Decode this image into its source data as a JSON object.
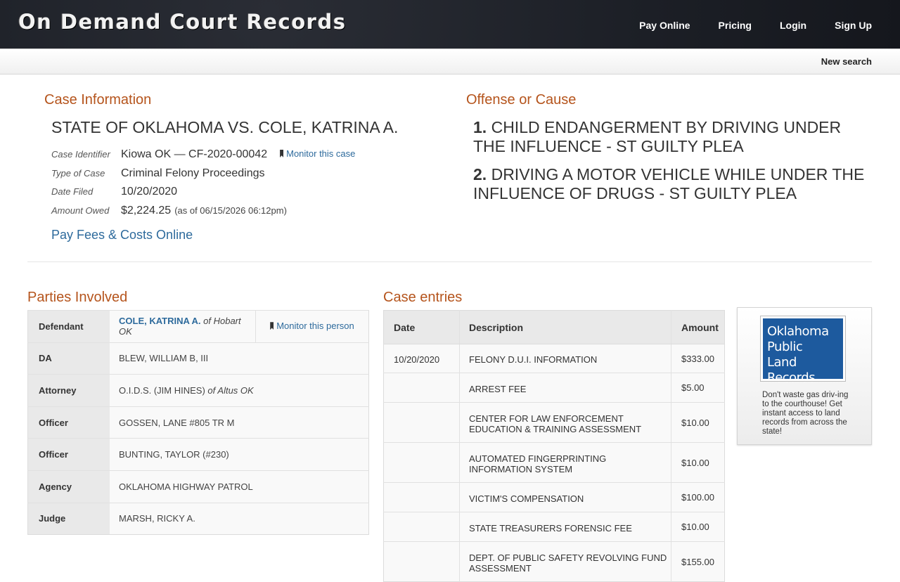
{
  "header": {
    "logo": "On Demand Court Records",
    "nav": [
      "Pay Online",
      "Pricing",
      "Login",
      "Sign Up"
    ],
    "new_search": "New search"
  },
  "case_info": {
    "heading": "Case Information",
    "title": "STATE OF OKLAHOMA VS. COLE, KATRINA A.",
    "fields": [
      {
        "label": "Case Identifier",
        "value": "Kiowa OK — CF-2020-00042"
      },
      {
        "label": "Type of Case",
        "value": "Criminal Felony Proceedings"
      },
      {
        "label": "Date Filed",
        "value": "10/20/2020"
      },
      {
        "label": "Amount Owed",
        "value": "$2,224.25",
        "note": "(as of 06/15/2026 06:12pm)"
      }
    ],
    "monitor_case": "Monitor this case",
    "pay_link": "Pay Fees & Costs Online"
  },
  "offense": {
    "heading": "Offense or Cause",
    "items": [
      {
        "num": "1.",
        "text": "CHILD ENDANGERMENT BY DRIVING UNDER THE INFLUENCE - ST GUILTY PLEA"
      },
      {
        "num": "2.",
        "text": "DRIVING A MOTOR VEHICLE WHILE UNDER THE INFLUENCE OF DRUGS - ST GUILTY PLEA"
      }
    ]
  },
  "parties": {
    "heading": "Parties Involved",
    "rows": [
      {
        "role": "Defendant",
        "name": "COLE, KATRINA A.",
        "suffix": "of Hobart OK",
        "monitor": "Monitor this person"
      },
      {
        "role": "DA",
        "name": "BLEW, WILLIAM B, III"
      },
      {
        "role": "Attorney",
        "name": "O.I.D.S. (JIM HINES)",
        "suffix": "of Altus OK"
      },
      {
        "role": "Officer",
        "name": "GOSSEN, LANE #805 TR M"
      },
      {
        "role": "Officer",
        "name": "BUNTING, TAYLOR (#230)"
      },
      {
        "role": "Agency",
        "name": "OKLAHOMA HIGHWAY PATROL"
      },
      {
        "role": "Judge",
        "name": "MARSH, RICKY A."
      }
    ]
  },
  "entries": {
    "heading": "Case entries",
    "columns": [
      "Date",
      "Description",
      "Amount"
    ],
    "rows": [
      {
        "date": "10/20/2020",
        "desc": "FELONY D.U.I. INFORMATION",
        "amount": "$333.00"
      },
      {
        "date": "",
        "desc": "ARREST FEE",
        "amount": "$5.00"
      },
      {
        "date": "",
        "desc": "CENTER FOR LAW ENFORCEMENT EDUCATION & TRAINING ASSESSMENT",
        "amount": "$10.00"
      },
      {
        "date": "",
        "desc": "AUTOMATED FINGERPRINTING INFORMATION SYSTEM",
        "amount": "$10.00"
      },
      {
        "date": "",
        "desc": "VICTIM'S COMPENSATION",
        "amount": "$100.00"
      },
      {
        "date": "",
        "desc": "STATE TREASURERS FORENSIC FEE",
        "amount": "$10.00"
      },
      {
        "date": "",
        "desc": "DEPT. OF PUBLIC SAFETY REVOLVING FUND ASSESSMENT",
        "amount": "$155.00"
      }
    ]
  },
  "ad": {
    "logo_lines": [
      "Oklahoma",
      "Public",
      "Land Records"
    ],
    "text": "Don't waste gas driv-ing to the courthouse! Get instant access to land records from across the state!"
  }
}
